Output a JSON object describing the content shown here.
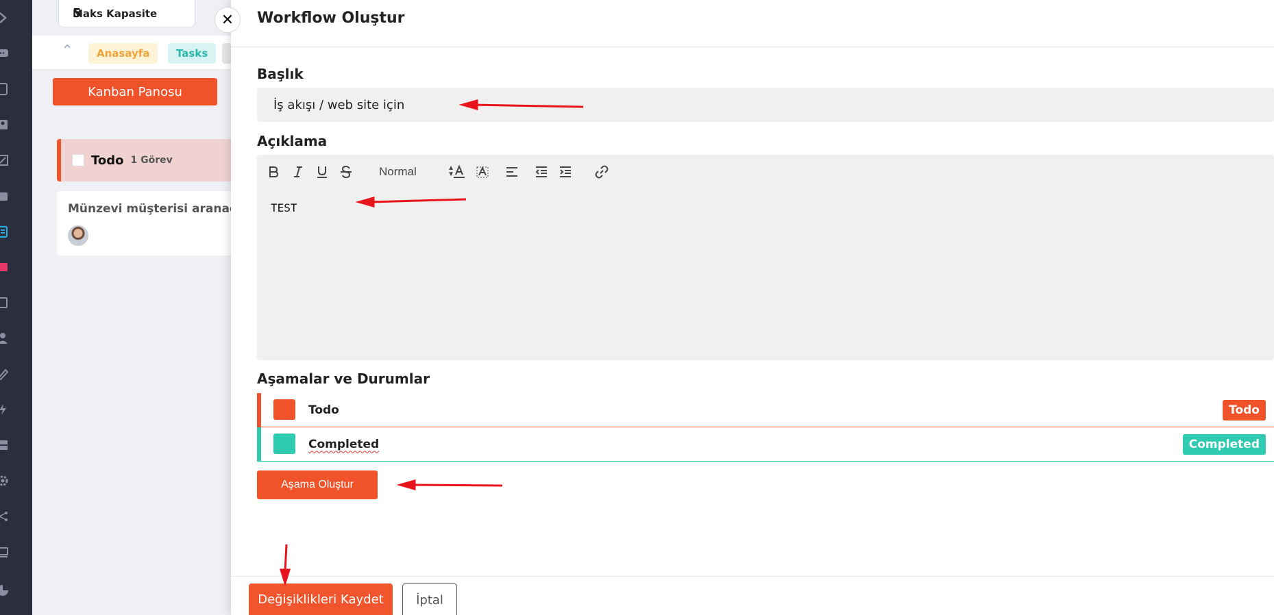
{
  "capacity": {
    "number": "5",
    "label": "Maks Kapasite"
  },
  "breadcrumbs": [
    {
      "label": "Anasayfa"
    },
    {
      "label": "Tasks"
    }
  ],
  "board": {
    "kanban_button": "Kanban Panosu",
    "column": {
      "title": "Todo",
      "count": "1 Görev"
    },
    "card": {
      "title": "Münzevi müşterisi aranacak"
    }
  },
  "modal": {
    "title": "Workflow Oluştur",
    "title_label": "Başlık",
    "title_value": "İş akışı / web site için",
    "description_label": "Açıklama",
    "editor": {
      "format_select": "Normal",
      "content": "TEST",
      "tools": [
        "bold-icon",
        "italic-icon",
        "underline-icon",
        "strikethrough-icon",
        "text-color-icon",
        "background-color-icon",
        "align-icon",
        "outdent-icon",
        "indent-icon",
        "link-icon"
      ]
    },
    "stages_label": "Aşamalar ve Durumlar",
    "stages": [
      {
        "name": "Todo",
        "badge": "Todo",
        "color": "#f0522a"
      },
      {
        "name": "Completed",
        "badge": "Completed",
        "color": "#2ecbb0"
      }
    ],
    "create_stage_button": "Aşama Oluştur",
    "save_button": "Değişiklikleri Kaydet",
    "cancel_button": "İptal"
  },
  "colors": {
    "accent": "#f0522a",
    "teal": "#2ecbb0",
    "sidebar": "#2b2f3d",
    "annotation_arrow": "#e8141c"
  }
}
